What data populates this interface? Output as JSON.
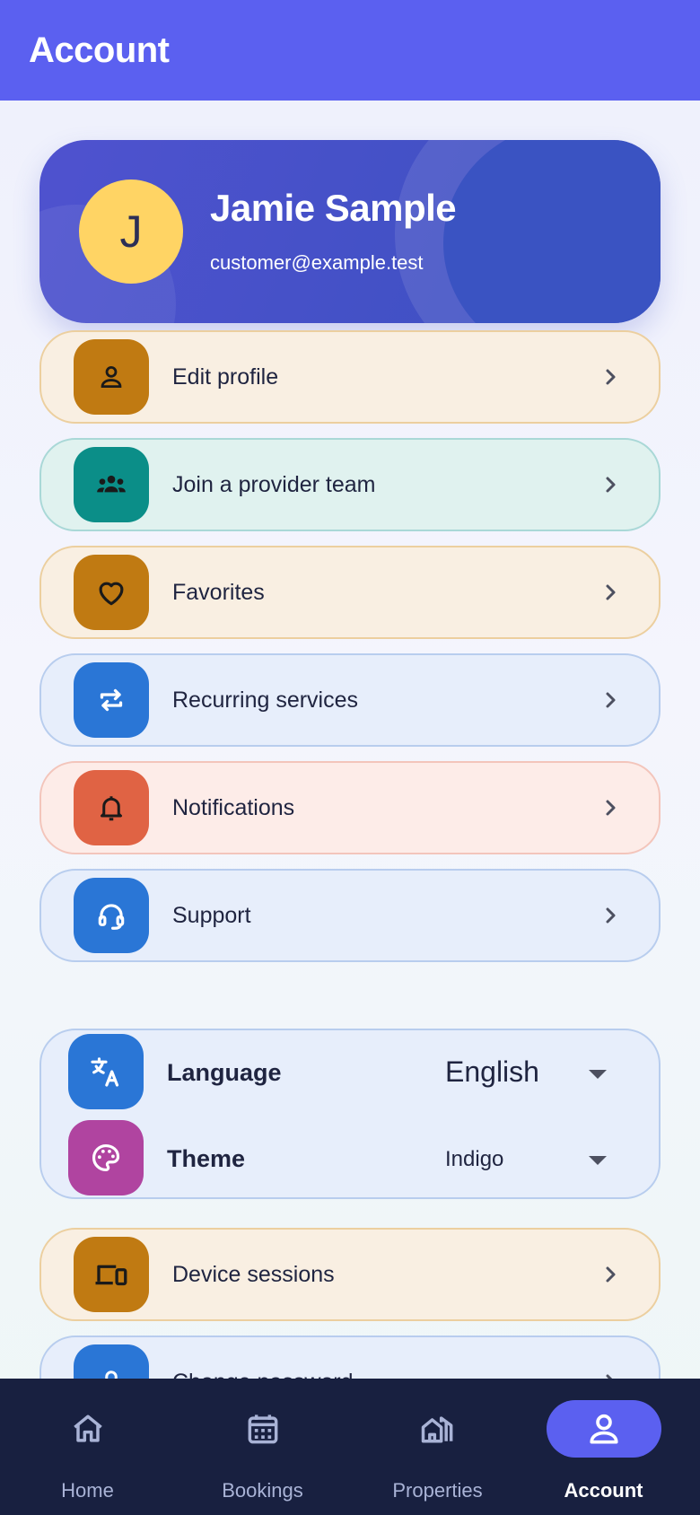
{
  "header": {
    "title": "Account"
  },
  "profile": {
    "initial": "J",
    "name": "Jamie Sample",
    "email": "customer@example.test"
  },
  "menu": [
    {
      "label": "Edit profile",
      "icon": "person-icon",
      "theme": "amber",
      "tile_color": "#c07a12"
    },
    {
      "label": "Join a provider team",
      "icon": "group-icon",
      "theme": "teal",
      "tile_color": "#0b8e88"
    },
    {
      "label": "Favorites",
      "icon": "heart-icon",
      "theme": "amber",
      "tile_color": "#c07a12"
    },
    {
      "label": "Recurring services",
      "icon": "repeat-icon",
      "theme": "blue",
      "tile_color": "#2a76d6"
    },
    {
      "label": "Notifications",
      "icon": "bell-icon",
      "theme": "coral",
      "tile_color": "#e06344"
    },
    {
      "label": "Support",
      "icon": "headset-icon",
      "theme": "blue",
      "tile_color": "#2a76d6"
    }
  ],
  "preferences": {
    "language": {
      "label": "Language",
      "value": "English",
      "icon": "translate-icon",
      "tile_color": "#2a76d6"
    },
    "theme": {
      "label": "Theme",
      "value": "Indigo",
      "icon": "palette-icon",
      "tile_color": "#b044a0"
    }
  },
  "security": [
    {
      "label": "Device sessions",
      "icon": "devices-icon",
      "theme": "amber",
      "tile_color": "#c07a12"
    },
    {
      "label": "Change password",
      "icon": "lock-icon",
      "theme": "blue",
      "tile_color": "#2a76d6"
    }
  ],
  "nav": [
    {
      "label": "Home",
      "icon": "home-icon",
      "active": false
    },
    {
      "label": "Bookings",
      "icon": "calendar-icon",
      "active": false
    },
    {
      "label": "Properties",
      "icon": "buildings-icon",
      "active": false
    },
    {
      "label": "Account",
      "icon": "person-icon",
      "active": true
    }
  ],
  "colors": {
    "primary": "#5b60f0",
    "nav_background": "#182040",
    "avatar": "#ffd464"
  }
}
